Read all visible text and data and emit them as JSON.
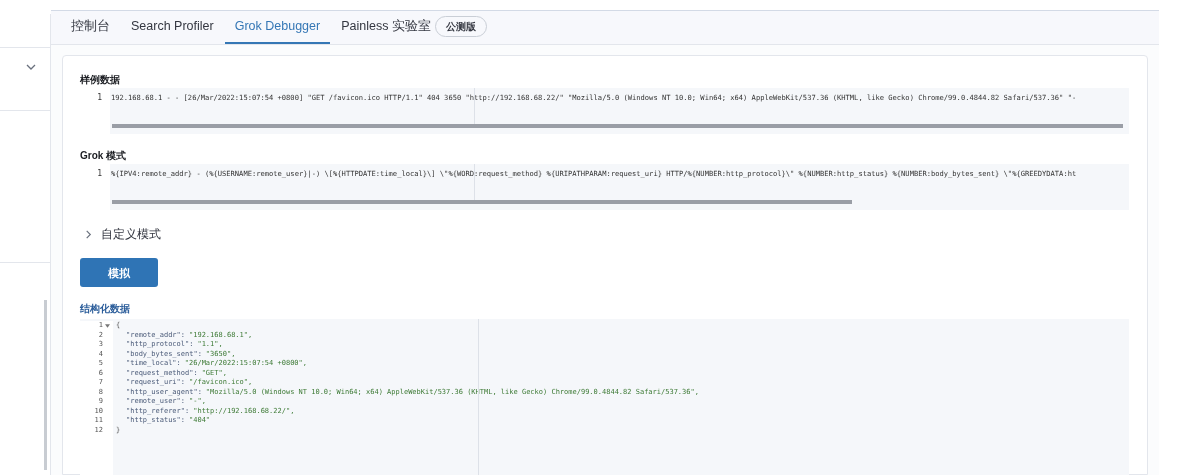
{
  "tabs": [
    {
      "label": "控制台",
      "selected": false
    },
    {
      "label": "Search Profiler",
      "selected": false
    },
    {
      "label": "Grok Debugger",
      "selected": true
    },
    {
      "label": "Painless 实验室",
      "selected": false,
      "badge": "公测版"
    }
  ],
  "sample_data": {
    "label": "样例数据",
    "lines": [
      {
        "number": "1",
        "text": "192.168.68.1 - - [26/Mar/2022:15:07:54 +0800] \"GET /favicon.ico HTTP/1.1\" 404 3650 \"http://192.168.68.22/\" \"Mozilla/5.0 (Windows NT 10.0; Win64; x64) AppleWebKit/537.36 (KHTML, like Gecko) Chrome/99.0.4844.82 Safari/537.36\" \"-"
      }
    ]
  },
  "grok_pattern": {
    "label": "Grok 模式",
    "lines": [
      {
        "number": "1",
        "text": "%{IPV4:remote_addr} - (%{USERNAME:remote_user}|-) \\[%{HTTPDATE:time_local}\\] \\\"%{WORD:request_method} %{URIPATHPARAM:request_uri} HTTP/%{NUMBER:http_protocol}\\\" %{NUMBER:http_status} %{NUMBER:body_bytes_sent} \\\"%{GREEDYDATA:ht"
      }
    ]
  },
  "custom_patterns": {
    "label": "自定义模式",
    "expanded": false
  },
  "simulate_button": "模拟",
  "structured_data": {
    "label": "结构化数据",
    "lines": [
      {
        "number": "1",
        "kind": "brace",
        "text": "{",
        "foldable": true
      },
      {
        "number": "2",
        "kind": "pair",
        "key": "\"remote_addr\":",
        "value": "\"192.168.68.1\","
      },
      {
        "number": "3",
        "kind": "pair",
        "key": "\"http_protocol\":",
        "value": "\"1.1\","
      },
      {
        "number": "4",
        "kind": "pair",
        "key": "\"body_bytes_sent\":",
        "value": "\"3650\","
      },
      {
        "number": "5",
        "kind": "pair",
        "key": "\"time_local\":",
        "value": "\"26/Mar/2022:15:07:54 +0800\","
      },
      {
        "number": "6",
        "kind": "pair",
        "key": "\"request_method\":",
        "value": "\"GET\","
      },
      {
        "number": "7",
        "kind": "pair",
        "key": "\"request_uri\":",
        "value": "\"/favicon.ico\","
      },
      {
        "number": "8",
        "kind": "pair",
        "key": "\"http_user_agent\":",
        "value": "\"Mozilla/5.0 (Windows NT 10.0; Win64; x64) AppleWebKit/537.36 (KHTML, like Gecko) Chrome/99.0.4844.82 Safari/537.36\","
      },
      {
        "number": "9",
        "kind": "pair",
        "key": "\"remote_user\":",
        "value": "\"-\","
      },
      {
        "number": "10",
        "kind": "pair",
        "key": "\"http_referer\":",
        "value": "\"http://192.168.68.22/\","
      },
      {
        "number": "11",
        "kind": "pair",
        "key": "\"http_status\":",
        "value": "\"404\""
      },
      {
        "number": "12",
        "kind": "brace",
        "text": "}",
        "foldable": false
      }
    ]
  }
}
